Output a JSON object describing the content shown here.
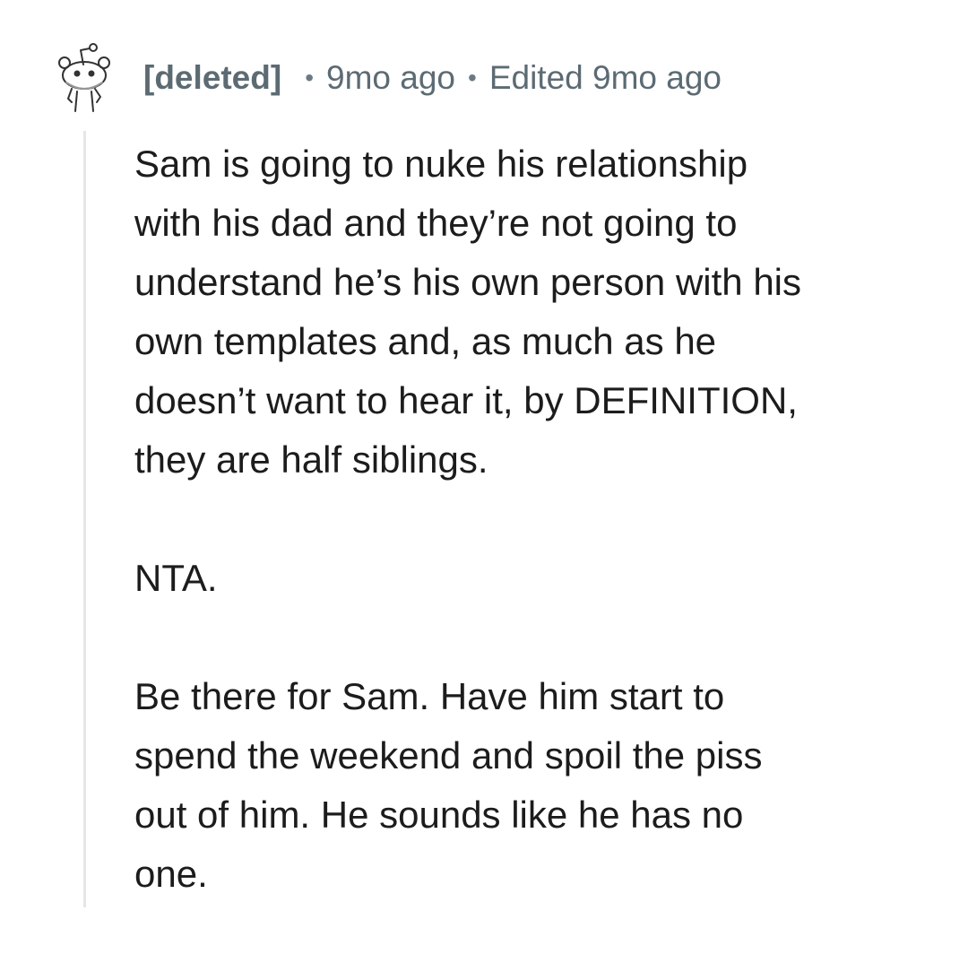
{
  "comment": {
    "author": "[deleted]",
    "time_posted": "9mo ago",
    "edited": "Edited 9mo ago",
    "avatar_icon": "snoo-avatar-icon",
    "separator": "•",
    "paragraphs": [
      "Sam is going to nuke his relationship\nwith his dad and they’re not going to\nunderstand he’s his own person with his\nown templates and, as much as he\ndoesn’t want to hear it, by DEFINITION,\nthey are half siblings.",
      "NTA.",
      "Be there for Sam. Have him start to\nspend the weekend and spoil the piss\nout of him. He sounds like he has no\none."
    ]
  },
  "colors": {
    "meta_text": "#5c6b73",
    "body_text": "#1c1c1c",
    "thread_line": "#e4e6e8",
    "background": "#ffffff"
  }
}
